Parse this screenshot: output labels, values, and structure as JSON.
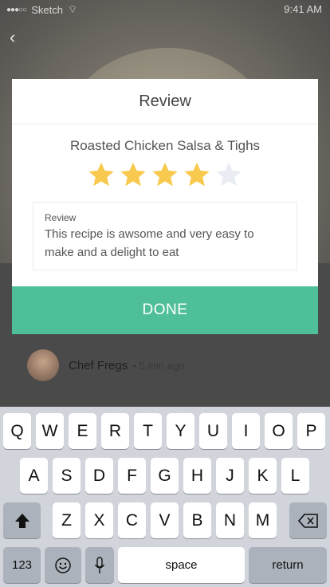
{
  "status_bar": {
    "carrier": "Sketch",
    "time": "9:41 AM"
  },
  "chef": {
    "name": "Chef Fregs",
    "extra": "• 5 min ago"
  },
  "modal": {
    "title": "Review",
    "recipe_name": "Roasted Chicken Salsa & Tighs",
    "rating": {
      "value": 4,
      "max": 5,
      "filled_color": "#f8c94e",
      "empty_color": "#e9ecf3"
    },
    "review_label": "Review",
    "review_text": "This recipe is awsome and very easy to make and a delight to eat",
    "done_label": "DONE",
    "done_color": "#4fbf9a"
  },
  "keyboard": {
    "row1": [
      "Q",
      "W",
      "E",
      "R",
      "T",
      "Y",
      "U",
      "I",
      "O",
      "P"
    ],
    "row2": [
      "A",
      "S",
      "D",
      "F",
      "G",
      "H",
      "J",
      "K",
      "L"
    ],
    "row3": [
      "Z",
      "X",
      "C",
      "V",
      "B",
      "N",
      "M"
    ],
    "numbers_label": "123",
    "space_label": "space",
    "return_label": "return",
    "shift_icon": "shift-icon",
    "delete_icon": "backspace-icon",
    "emoji_icon": "emoji-icon",
    "mic_icon": "microphone-icon"
  }
}
